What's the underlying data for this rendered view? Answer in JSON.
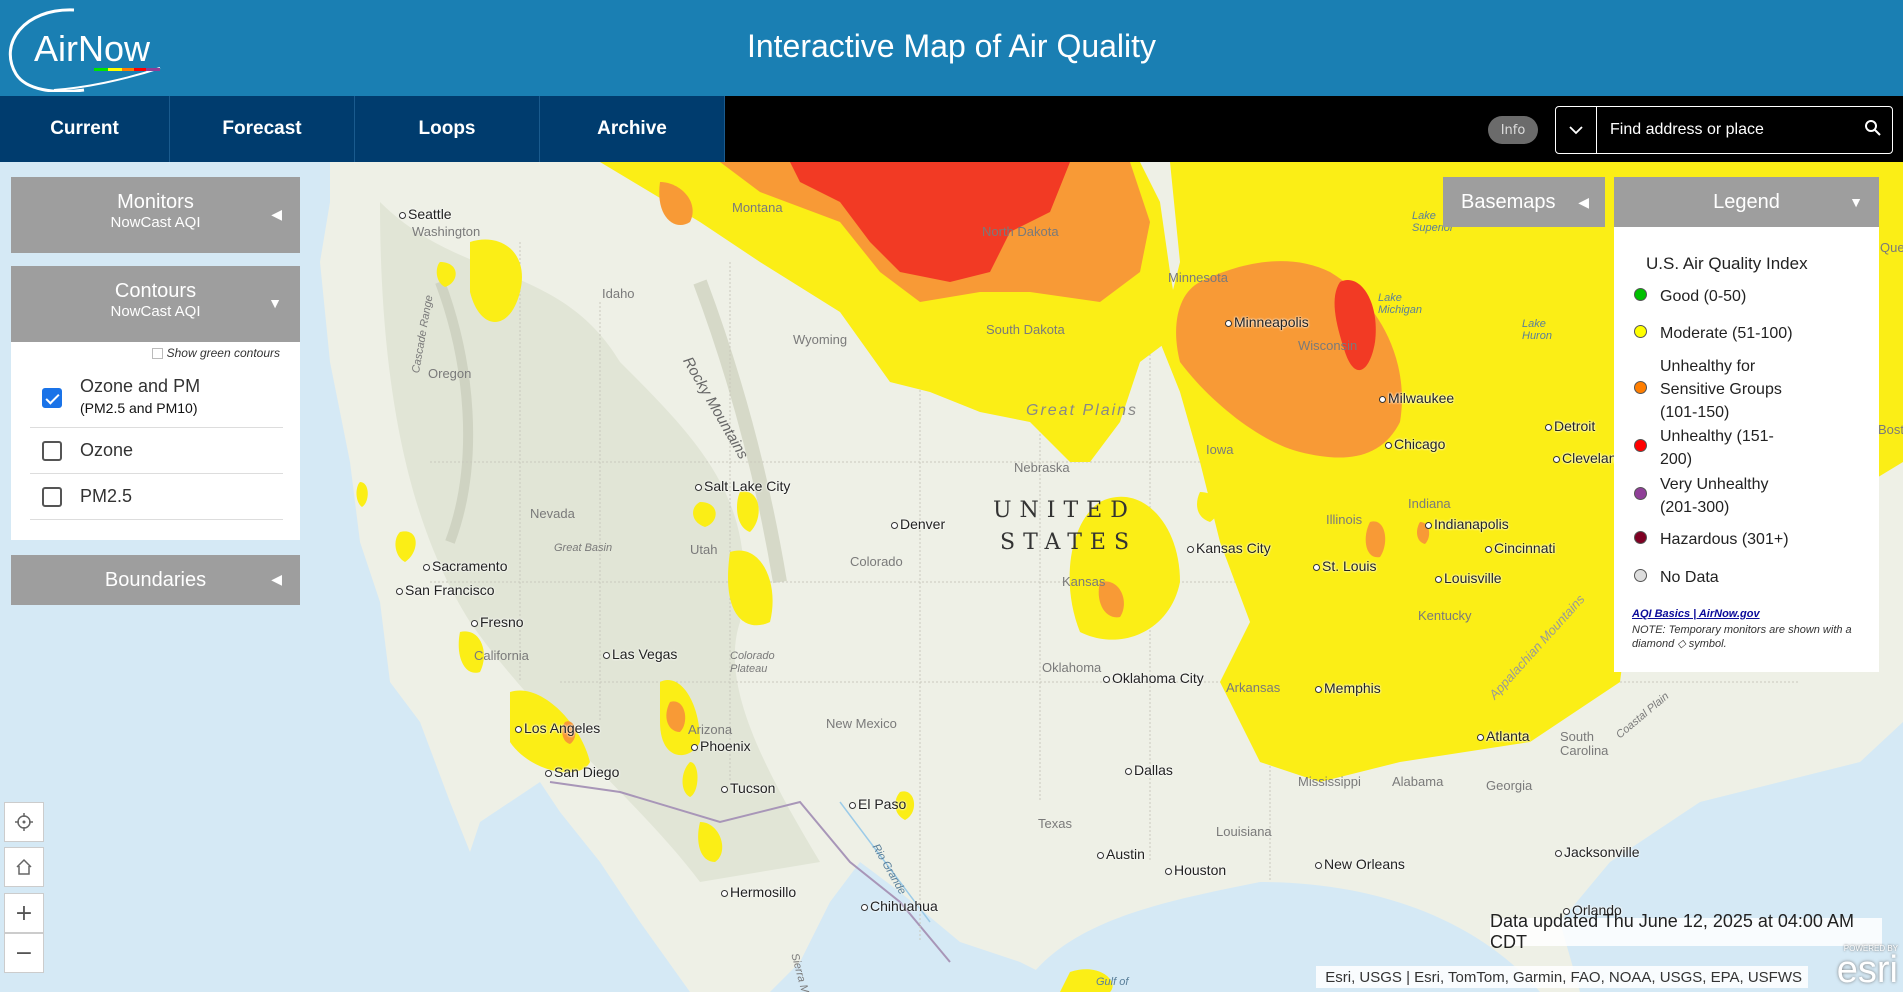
{
  "header": {
    "logo_text": "AirNow",
    "title": "Interactive Map of Air Quality"
  },
  "nav": {
    "tabs": [
      {
        "label": "Current"
      },
      {
        "label": "Forecast"
      },
      {
        "label": "Loops"
      },
      {
        "label": "Archive"
      }
    ],
    "info_label": "Info",
    "search_placeholder": "Find address or place"
  },
  "panels": {
    "monitors": {
      "title": "Monitors",
      "subtitle": "NowCast AQI"
    },
    "contours": {
      "title": "Contours",
      "subtitle": "NowCast AQI",
      "show_green": "Show green contours",
      "options": [
        {
          "label": "Ozone and PM",
          "sublabel": "(PM2.5 and PM10)",
          "checked": true
        },
        {
          "label": "Ozone",
          "checked": false
        },
        {
          "label": "PM2.5",
          "checked": false
        }
      ]
    },
    "boundaries": {
      "title": "Boundaries"
    }
  },
  "basemaps": {
    "label": "Basemaps"
  },
  "legend": {
    "header": "Legend",
    "title": "U.S. Air Quality Index",
    "items": [
      {
        "label": "Good (0-50)",
        "color": "#00c000"
      },
      {
        "label": "Moderate (51-100)",
        "color": "#ffff00"
      },
      {
        "label": "Unhealthy for Sensitive Groups (101-150)",
        "color": "#ff7e00"
      },
      {
        "label": "Unhealthy (151-200)",
        "color": "#ff0000"
      },
      {
        "label": "Very Unhealthy (201-300)",
        "color": "#8f3f97"
      },
      {
        "label": "Hazardous (301+)",
        "color": "#7e0023"
      },
      {
        "label": "No Data",
        "color": "#dddddd"
      }
    ],
    "link": "AQI Basics | AirNow.gov",
    "note": "NOTE: Temporary monitors are shown with a diamond ◇ symbol."
  },
  "map": {
    "country_line1": "UNITED",
    "country_line2": "STATES",
    "cities": [
      {
        "name": "Seattle"
      },
      {
        "name": "Sacramento"
      },
      {
        "name": "San Francisco"
      },
      {
        "name": "Fresno"
      },
      {
        "name": "Los Angeles"
      },
      {
        "name": "San Diego"
      },
      {
        "name": "Las Vegas"
      },
      {
        "name": "Phoenix"
      },
      {
        "name": "Tucson"
      },
      {
        "name": "Salt Lake City"
      },
      {
        "name": "Denver"
      },
      {
        "name": "El Paso"
      },
      {
        "name": "Hermosillo"
      },
      {
        "name": "Chihuahua"
      },
      {
        "name": "Oklahoma City"
      },
      {
        "name": "Dallas"
      },
      {
        "name": "Austin"
      },
      {
        "name": "Houston"
      },
      {
        "name": "Kansas City"
      },
      {
        "name": "Minneapolis"
      },
      {
        "name": "Milwaukee"
      },
      {
        "name": "Chicago"
      },
      {
        "name": "St. Louis"
      },
      {
        "name": "Indianapolis"
      },
      {
        "name": "Cincinnati"
      },
      {
        "name": "Louisville"
      },
      {
        "name": "Memphis"
      },
      {
        "name": "New Orleans"
      },
      {
        "name": "Atlanta"
      },
      {
        "name": "Jacksonville"
      },
      {
        "name": "Orlando"
      },
      {
        "name": "Detroit"
      },
      {
        "name": "Clevelan"
      }
    ],
    "regions": [
      {
        "name": "Washington"
      },
      {
        "name": "Oregon"
      },
      {
        "name": "Idaho"
      },
      {
        "name": "Montana"
      },
      {
        "name": "Wyoming"
      },
      {
        "name": "Nevada"
      },
      {
        "name": "Utah"
      },
      {
        "name": "Colorado"
      },
      {
        "name": "Arizona"
      },
      {
        "name": "New Mexico"
      },
      {
        "name": "California"
      },
      {
        "name": "North Dakota"
      },
      {
        "name": "South Dakota"
      },
      {
        "name": "Nebraska"
      },
      {
        "name": "Kansas"
      },
      {
        "name": "Oklahoma"
      },
      {
        "name": "Texas"
      },
      {
        "name": "Minnesota"
      },
      {
        "name": "Iowa"
      },
      {
        "name": "Wisconsin"
      },
      {
        "name": "Illinois"
      },
      {
        "name": "Indiana"
      },
      {
        "name": "Kentucky"
      },
      {
        "name": "Arkansas"
      },
      {
        "name": "Mississippi"
      },
      {
        "name": "Alabama"
      },
      {
        "name": "Louisiana"
      },
      {
        "name": "Georgia"
      },
      {
        "name": "South Carolina"
      },
      {
        "name": "Great Basin"
      },
      {
        "name": "Colorado Plateau"
      },
      {
        "name": "Rocky Mountains"
      },
      {
        "name": "Great Plains"
      },
      {
        "name": "Cascade Range"
      },
      {
        "name": "Appalachian Mountains"
      },
      {
        "name": "Coastal Plain"
      },
      {
        "name": "Lake Superior"
      },
      {
        "name": "Lake Michigan"
      },
      {
        "name": "Lake Huron"
      },
      {
        "name": "Rio Grande"
      },
      {
        "name": "Sierra Madre"
      },
      {
        "name": "Gulf of"
      },
      {
        "name": "Boston"
      },
      {
        "name": "Quebec"
      }
    ]
  },
  "footer": {
    "data_updated": "Data updated Thu June 12, 2025 at 04:00 AM CDT",
    "attribution": "Esri, USGS | Esri, TomTom, Garmin, FAO, NOAA, USGS, EPA, USFWS",
    "esri_powered": "POWERED BY",
    "esri_name": "esri"
  }
}
